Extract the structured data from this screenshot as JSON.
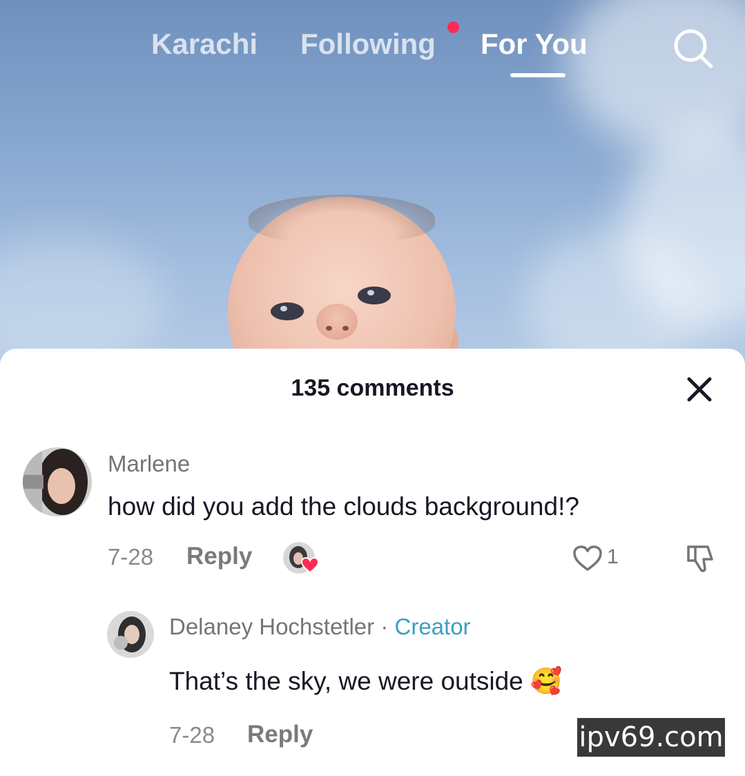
{
  "top_nav": {
    "tabs": [
      {
        "label": "Karachi"
      },
      {
        "label": "Following"
      },
      {
        "label": "For You"
      }
    ],
    "active_tab": "For You",
    "search_icon": "search-icon"
  },
  "comments_sheet": {
    "title": "135 comments",
    "close_icon": "close-icon",
    "comments": [
      {
        "username": "Marlene",
        "text": "how did you add the clouds background!?",
        "date": "7-28",
        "reply_label": "Reply",
        "likes": "1"
      }
    ],
    "replies": [
      {
        "username": "Delaney Hochstetler",
        "separator": "·",
        "badge": "Creator",
        "text": "That’s the sky, we were outside",
        "emoji": "🥰",
        "date": "7-28",
        "reply_label": "Reply"
      }
    ]
  },
  "watermark": "ipv69.com",
  "colors": {
    "accent_red": "#fe2c55",
    "creator_blue": "#3e9ec3",
    "text_dark": "#161823",
    "text_muted": "#757575"
  }
}
